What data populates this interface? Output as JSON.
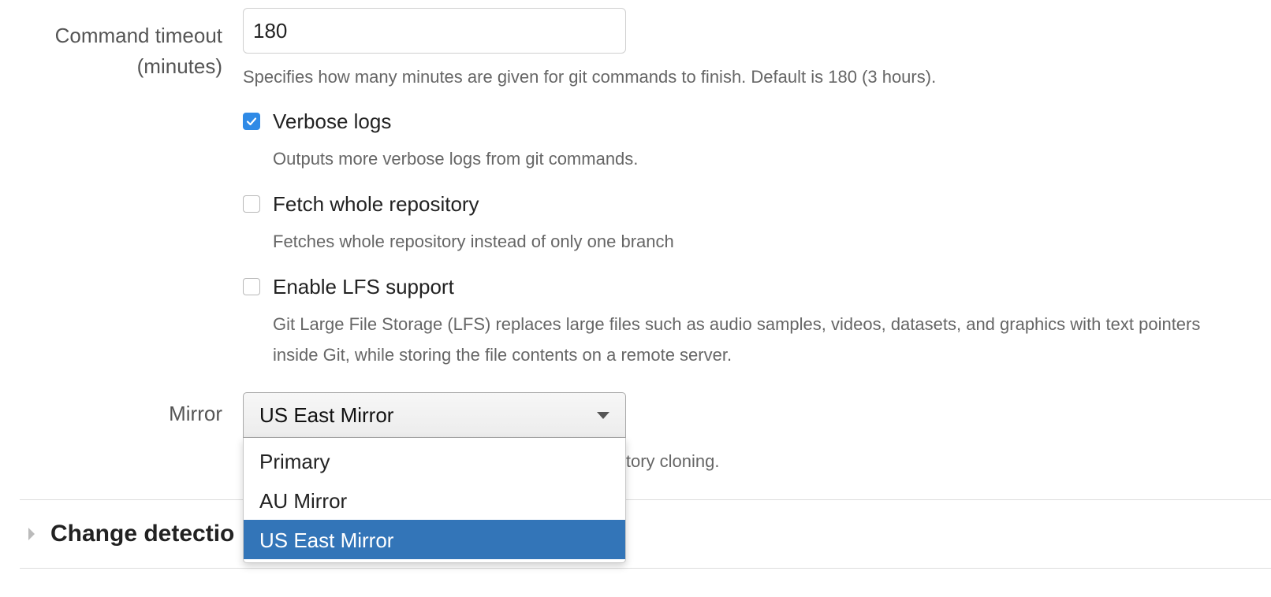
{
  "timeout": {
    "label": "Command timeout (minutes)",
    "value": "180",
    "help": "Specifies how many minutes are given for git commands to finish. Default is 180 (3 hours)."
  },
  "verbose_logs": {
    "label": "Verbose logs",
    "checked": true,
    "help": "Outputs more verbose logs from git commands."
  },
  "fetch_whole": {
    "label": "Fetch whole repository",
    "checked": false,
    "help": "Fetches whole repository instead of only one branch"
  },
  "lfs": {
    "label": "Enable LFS support",
    "checked": false,
    "help": "Git Large File Storage (LFS) replaces large files such as audio samples, videos, datasets, and graphics with text pointers inside Git, while storing the file contents on a remote server."
  },
  "mirror": {
    "label": "Mirror",
    "selected": "US East Mirror",
    "help_visible": "sitory cloning.",
    "options": [
      "Primary",
      "AU Mirror",
      "US East Mirror"
    ]
  },
  "section": {
    "title": "Change detectio"
  },
  "colors": {
    "checkbox_checked": "#2f8ae6",
    "dropdown_selected": "#3375b8"
  }
}
